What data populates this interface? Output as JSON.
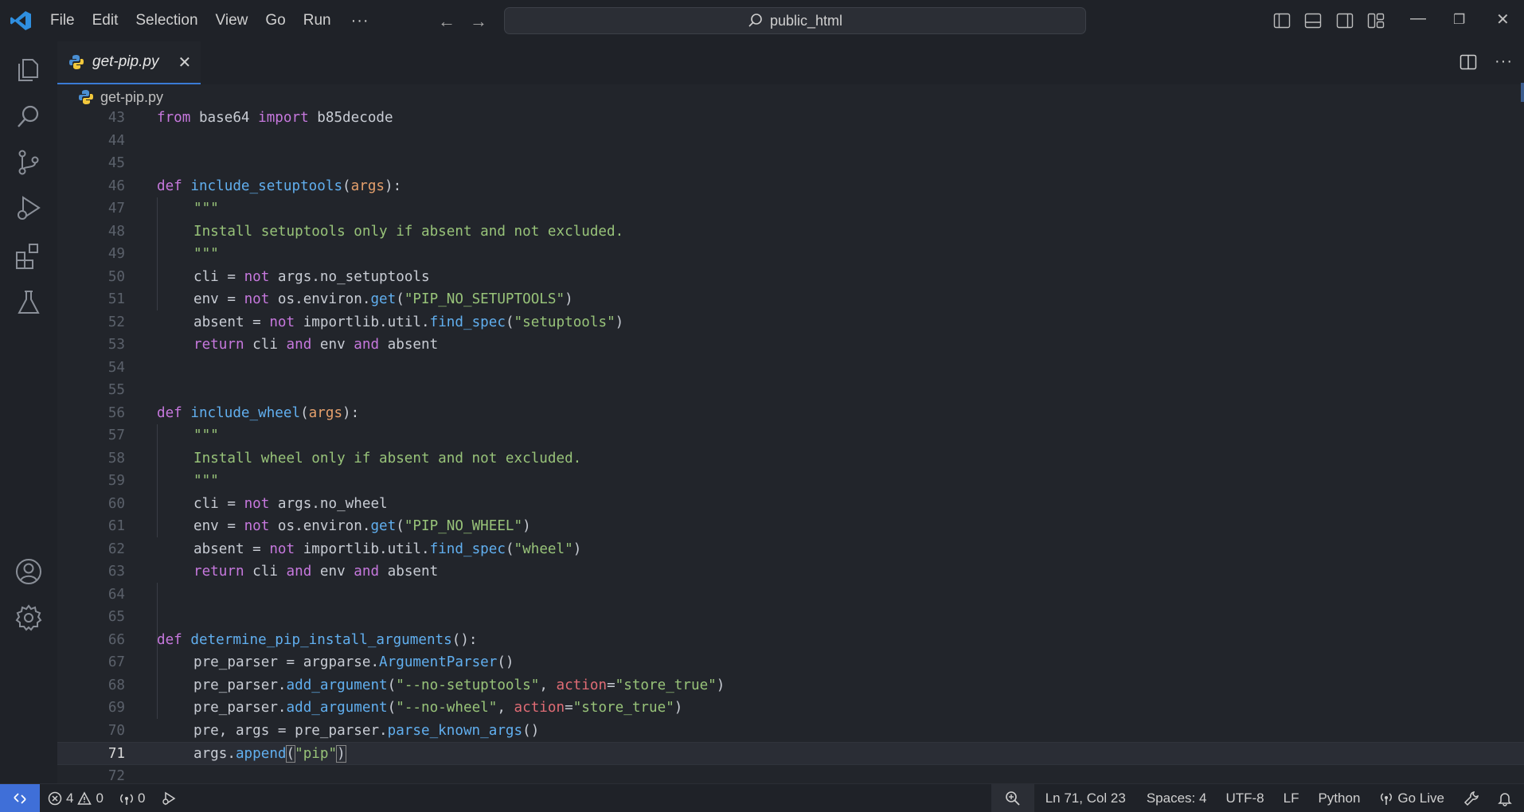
{
  "menu": [
    "File",
    "Edit",
    "Selection",
    "View",
    "Go",
    "Run"
  ],
  "menu_more": "···",
  "search": {
    "label": "public_html"
  },
  "tab": {
    "label": "get-pip.py",
    "close": "✕"
  },
  "breadcrumb": {
    "file": "get-pip.py"
  },
  "colors": {
    "accent": "#3f6fd8",
    "keyword": "#c678dd",
    "function": "#61afef",
    "string": "#98c379",
    "param": "#e5a06c",
    "kwarg": "#e06c75"
  },
  "code_lines": [
    {
      "n": "43"
    },
    {
      "n": "44"
    },
    {
      "n": "45"
    },
    {
      "n": "46"
    },
    {
      "n": "47"
    },
    {
      "n": "48"
    },
    {
      "n": "49"
    },
    {
      "n": "50"
    },
    {
      "n": "51"
    },
    {
      "n": "52"
    },
    {
      "n": "53"
    },
    {
      "n": "54"
    },
    {
      "n": "55"
    },
    {
      "n": "56"
    },
    {
      "n": "57"
    },
    {
      "n": "58"
    },
    {
      "n": "59"
    },
    {
      "n": "60"
    },
    {
      "n": "61"
    },
    {
      "n": "62"
    },
    {
      "n": "63"
    },
    {
      "n": "64"
    },
    {
      "n": "65"
    },
    {
      "n": "66"
    },
    {
      "n": "67"
    },
    {
      "n": "68"
    },
    {
      "n": "69"
    },
    {
      "n": "70"
    },
    {
      "n": "71"
    },
    {
      "n": "72"
    }
  ],
  "code": {
    "l43": [
      "from",
      " base64 ",
      "import",
      " b85decode"
    ],
    "l46": [
      "def",
      " ",
      "include_setuptools",
      "(",
      "args",
      "):"
    ],
    "l47": "\"\"\"",
    "l48": "Install setuptools only if absent and not excluded.",
    "l49": "\"\"\"",
    "l50": [
      "cli = ",
      "not",
      " args.no_setuptools"
    ],
    "l51": [
      "env = ",
      "not",
      " os.environ.",
      "get",
      "(",
      "\"PIP_NO_SETUPTOOLS\"",
      ")"
    ],
    "l52": [
      "absent = ",
      "not",
      " importlib.util.",
      "find_spec",
      "(",
      "\"setuptools\"",
      ")"
    ],
    "l53": [
      "return",
      " cli ",
      "and",
      " env ",
      "and",
      " absent"
    ],
    "l56": [
      "def",
      " ",
      "include_wheel",
      "(",
      "args",
      "):"
    ],
    "l57": "\"\"\"",
    "l58": "Install wheel only if absent and not excluded.",
    "l59": "\"\"\"",
    "l60": [
      "cli = ",
      "not",
      " args.no_wheel"
    ],
    "l61": [
      "env = ",
      "not",
      " os.environ.",
      "get",
      "(",
      "\"PIP_NO_WHEEL\"",
      ")"
    ],
    "l62": [
      "absent = ",
      "not",
      " importlib.util.",
      "find_spec",
      "(",
      "\"wheel\"",
      ")"
    ],
    "l63": [
      "return",
      " cli ",
      "and",
      " env ",
      "and",
      " absent"
    ],
    "l66": [
      "def",
      " ",
      "determine_pip_install_arguments",
      "():"
    ],
    "l67": [
      "pre_parser = argparse.",
      "ArgumentParser",
      "()"
    ],
    "l68": [
      "pre_parser.",
      "add_argument",
      "(",
      "\"--no-setuptools\"",
      ", ",
      "action",
      "=",
      "\"store_true\"",
      ")"
    ],
    "l69": [
      "pre_parser.",
      "add_argument",
      "(",
      "\"--no-wheel\"",
      ", ",
      "action",
      "=",
      "\"store_true\"",
      ")"
    ],
    "l70": [
      "pre, args = pre_parser.",
      "parse_known_args",
      "()"
    ],
    "l71": [
      "args.",
      "append",
      "(",
      "\"pip\"",
      ")"
    ]
  },
  "status": {
    "errors": "4",
    "warnings": "0",
    "ports": "0",
    "position": "Ln 71, Col 23",
    "spaces": "Spaces: 4",
    "encoding": "UTF-8",
    "eol": "LF",
    "language": "Python",
    "golive": "Go Live"
  }
}
